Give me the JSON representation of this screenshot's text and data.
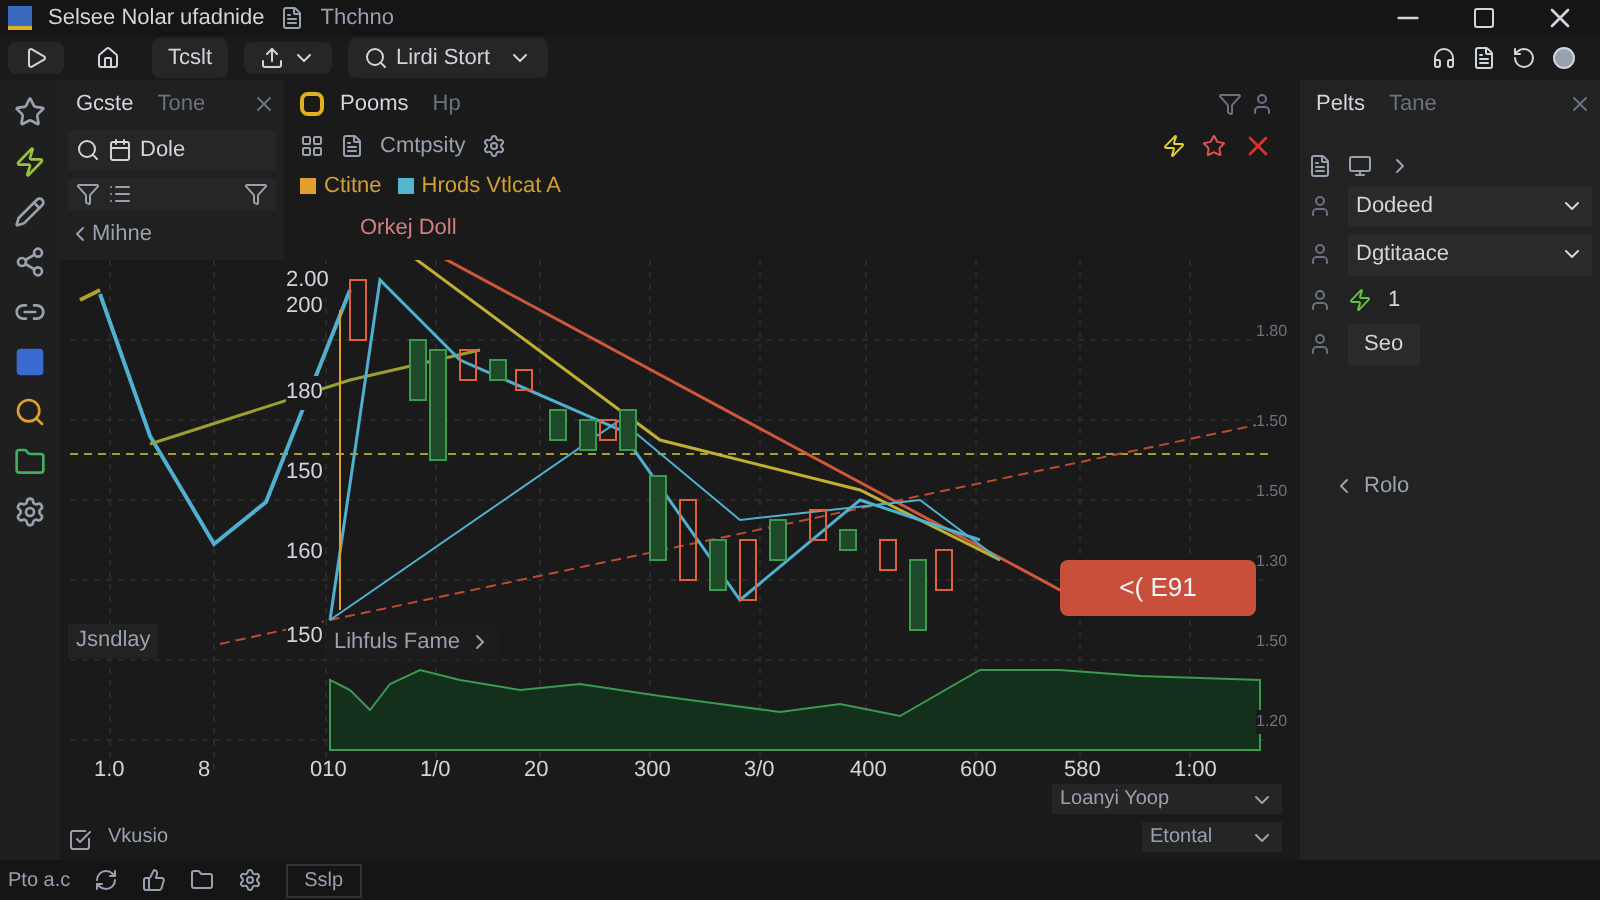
{
  "window": {
    "title": "Selsee Nolar ufadnide",
    "subtitle": "Thchno"
  },
  "toolbar": {
    "button": "Tcslt",
    "dropdown": "Lirdi Stort"
  },
  "left_panel": {
    "tabs": [
      {
        "label": "Gcste",
        "selected": true
      },
      {
        "label": "Tone",
        "selected": false
      }
    ],
    "search": "Dole",
    "back_link": "Mihne"
  },
  "chart_panel": {
    "tabs": [
      {
        "label": "Pooms",
        "selected": true
      },
      {
        "label": "Hp",
        "selected": false
      }
    ],
    "toolbar_label": "Cmtpsity",
    "legend": [
      "Ctitne",
      "Hrods Vtlcat A"
    ],
    "legend_2": "Orkej Doll",
    "y_ticks": [
      "2.00",
      "200",
      "180",
      "150",
      "160",
      "150"
    ],
    "x_ticks": [
      "1.0",
      "8",
      "010",
      "1/0",
      "20",
      "300",
      "3/0",
      "400",
      "600",
      "580",
      "1:00"
    ],
    "right_ticks": [
      "1.80",
      "1.50",
      "1.50",
      "1.30",
      "1.50",
      "1.20"
    ],
    "series_label": "Jsndlay",
    "range_dropdown": "Lihfuls Fame",
    "price_badge": "<( E91"
  },
  "right_panel": {
    "tabs": [
      {
        "label": "Pelts",
        "selected": true
      },
      {
        "label": "Tane",
        "selected": false
      }
    ],
    "rows": [
      {
        "kind": "select",
        "label": "Dodeed"
      },
      {
        "kind": "select",
        "label": "Dgtitaace"
      },
      {
        "kind": "value",
        "label": "1"
      },
      {
        "kind": "button",
        "label": "Seo"
      }
    ],
    "back_link": "Rolo"
  },
  "footer": {
    "checkbox_label": "Vkusio",
    "dropdown_1": "Loanyi Yoop",
    "dropdown_2": "Etontal"
  },
  "status_bar": {
    "text": "Pto a.c",
    "button": "Sslp"
  }
}
